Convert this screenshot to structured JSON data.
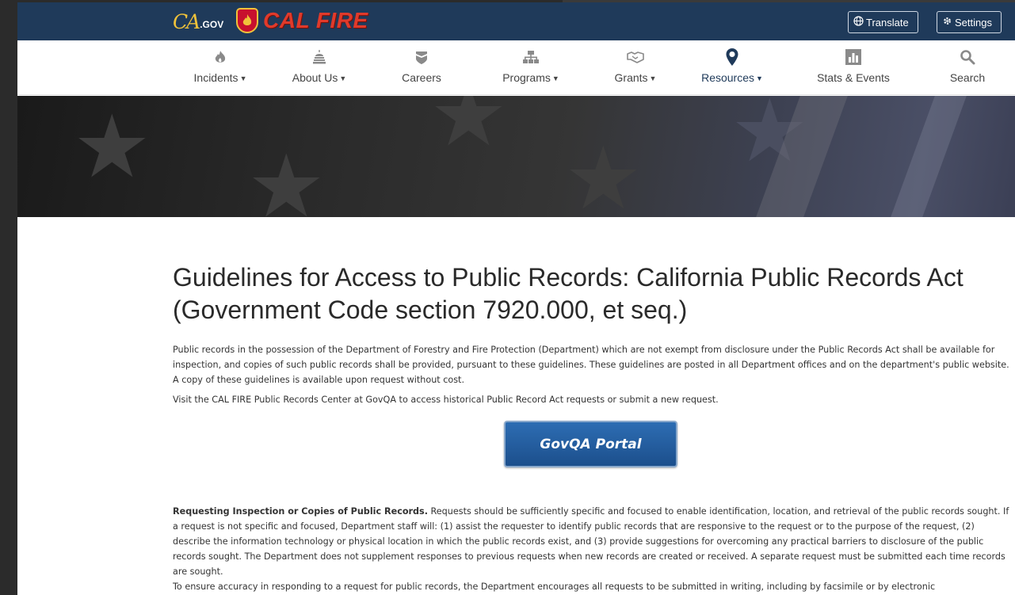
{
  "header": {
    "ca_gov_logo": {
      "ca": "CA",
      "gov": ".GOV"
    },
    "calfire_logo": {
      "badge": "CAL FIRE",
      "text": "CAL FIRE"
    },
    "translate_label": "Translate",
    "settings_label": "Settings"
  },
  "nav": {
    "items": [
      {
        "label": "Incidents",
        "icon": "fire-icon",
        "has_dropdown": true
      },
      {
        "label": "About Us",
        "icon": "capitol-icon",
        "has_dropdown": true
      },
      {
        "label": "Careers",
        "icon": "shield-chevron-icon",
        "has_dropdown": false
      },
      {
        "label": "Programs",
        "icon": "sitemap-icon",
        "has_dropdown": true
      },
      {
        "label": "Grants",
        "icon": "handshake-icon",
        "has_dropdown": true
      },
      {
        "label": "Resources",
        "icon": "map-pin-icon",
        "has_dropdown": true,
        "active": true
      },
      {
        "label": "Stats & Events",
        "icon": "bar-chart-icon",
        "has_dropdown": false
      },
      {
        "label": "Search",
        "icon": "search-icon",
        "has_dropdown": false
      }
    ]
  },
  "main": {
    "title": "Guidelines for Access to Public Records: California Public Records Act (Government Code section 7920.000, et seq.)",
    "intro": "Public records in the possession of the Department of Forestry and Fire Protection (Department) which are not exempt from disclosure under the Public Records Act shall be available for inspection, and copies of such public records shall be provided, pursuant to these guidelines. These guidelines are posted in all Department offices and on the department's public website. A copy of these guidelines is available upon request without cost.",
    "visit": "Visit the CAL FIRE Public Records Center at GovQA to access historical Public Record Act requests or submit a new request.",
    "portal_button": "GovQA Portal",
    "requesting_heading": "Requesting Inspection or Copies of Public Records.",
    "requesting_body": " Requests should be sufficiently specific and focused to enable identification, location, and retrieval of the public records sought. If a request is not specific and focused, Department staff will: (1) assist the requester to identify public records that are responsive to the request or to the purpose of the request, (2) describe the information technology or physical location in which the public records exist, and (3) provide suggestions for overcoming any practical barriers to disclosure of the public records sought. The Department does not supplement responses to previous requests when new records are created or received. A separate request must be submitted each time records are sought.",
    "accuracy": "To ensure accuracy in responding to a request for public records, the Department encourages all requests to be submitted in writing, including by facsimile or by electronic"
  },
  "colors": {
    "header_bg": "#1f3a5a",
    "calfire_red": "#e03a2b",
    "active_nav": "#1f3a5a",
    "portal_button": "#1c4f8c"
  }
}
